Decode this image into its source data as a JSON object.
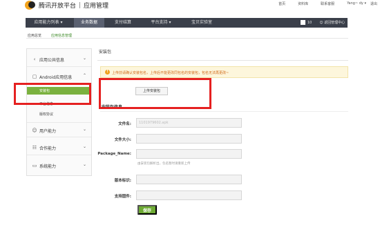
{
  "header": {
    "brand": "腾讯开放平台",
    "subtitle": "应用管理",
    "links": [
      "首页",
      "资料库",
      "联系客服"
    ],
    "user": "Yang~ dy ▾",
    "logout": "退出"
  },
  "nav": {
    "items": [
      {
        "label": "应用能力列表 ▾"
      },
      {
        "label": "业务数据"
      },
      {
        "label": "支付结算"
      },
      {
        "label": "平台支持 ▾"
      },
      {
        "label": "宝贝实验室"
      }
    ],
    "badge": "10",
    "dev_center": "☺ 返回管理中心"
  },
  "breadcrumb": {
    "items": [
      "应用总览",
      "应用信息管理"
    ]
  },
  "sidebar": {
    "groups": [
      {
        "icon": "share-icon",
        "label": "应用公共信息"
      },
      {
        "icon": "android-icon",
        "label": "Android应用信息"
      },
      {
        "icon": "user-icon",
        "label": "用户能力"
      },
      {
        "icon": "handshake-icon",
        "label": "合作能力"
      },
      {
        "icon": "monitor-icon",
        "label": "系统能力"
      }
    ],
    "sub": [
      {
        "label": "安装包"
      },
      {
        "label": "平台信息"
      },
      {
        "label": "版权协议"
      }
    ]
  },
  "main": {
    "title": "安装包",
    "alert": "上传前请确认安装包名，上传后不能更改同包名的安装包，包名无法再更改~",
    "upload_label": "上传安装包",
    "info_title": "安装包信息",
    "fields": [
      {
        "label": "文件名:",
        "value": "1101979602.apk"
      },
      {
        "label": "文件大小:",
        "value": ""
      },
      {
        "label": "Package_Name:",
        "value": ""
      },
      {
        "label": "版本标识:",
        "value": ""
      },
      {
        "label": "支持固件:",
        "value": ""
      }
    ],
    "hint": "由安装包解析出，包名暂时请重新上传",
    "save_label": "保存"
  },
  "colors": {
    "accent": "#6eab34",
    "nav_bg": "#3a3f4a",
    "highlight": "#e52020",
    "alert_bg": "#fdf6dc"
  }
}
